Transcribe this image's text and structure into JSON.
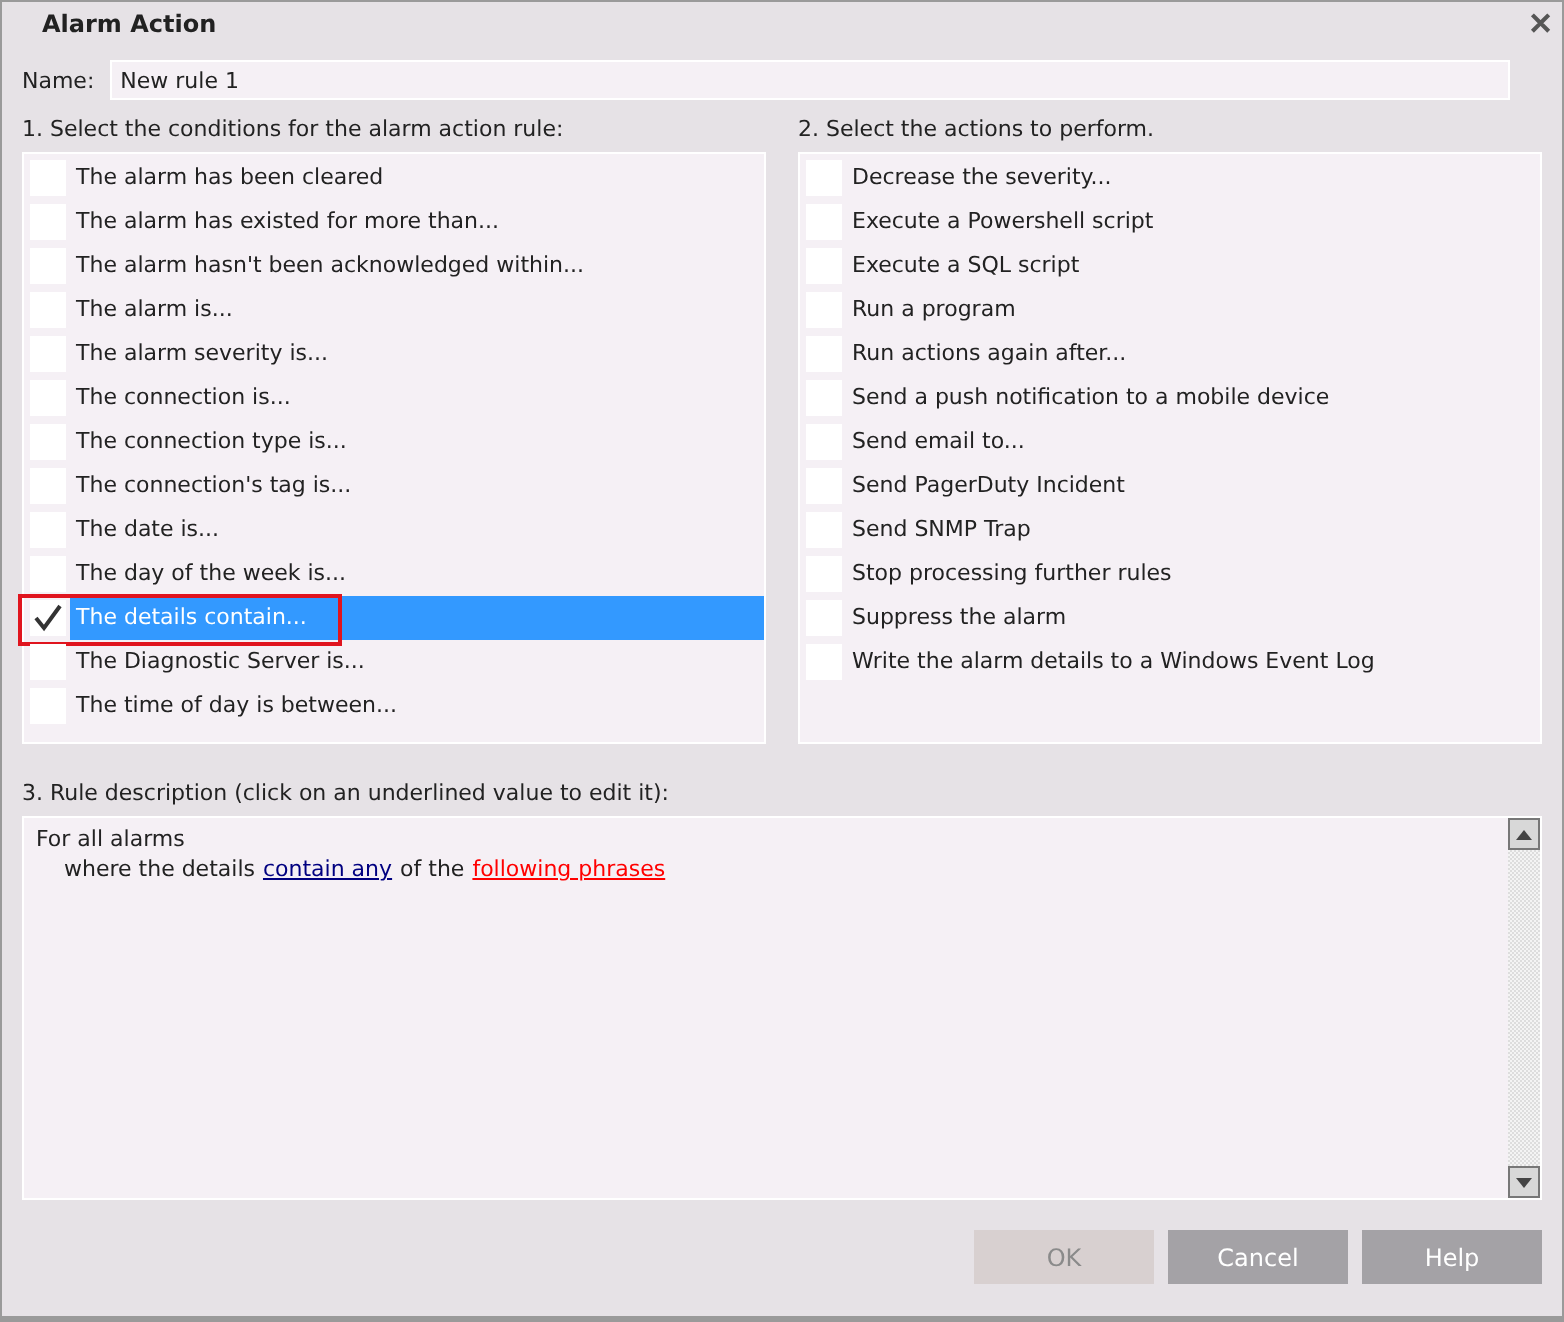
{
  "window": {
    "title": "Alarm Action",
    "close": "✕"
  },
  "name_field": {
    "label": "Name:",
    "value": "New rule 1"
  },
  "conditions": {
    "label": "1. Select the conditions for the alarm action rule:",
    "items": [
      {
        "label": "The alarm has been cleared",
        "checked": false,
        "selected": false,
        "highlighted": false
      },
      {
        "label": "The alarm has existed for more than...",
        "checked": false,
        "selected": false,
        "highlighted": false
      },
      {
        "label": "The alarm hasn't been acknowledged within...",
        "checked": false,
        "selected": false,
        "highlighted": false
      },
      {
        "label": "The alarm is...",
        "checked": false,
        "selected": false,
        "highlighted": false
      },
      {
        "label": "The alarm severity is...",
        "checked": false,
        "selected": false,
        "highlighted": false
      },
      {
        "label": "The connection is...",
        "checked": false,
        "selected": false,
        "highlighted": false
      },
      {
        "label": "The connection type is...",
        "checked": false,
        "selected": false,
        "highlighted": false
      },
      {
        "label": "The connection's tag is...",
        "checked": false,
        "selected": false,
        "highlighted": false
      },
      {
        "label": "The date is...",
        "checked": false,
        "selected": false,
        "highlighted": false
      },
      {
        "label": "The day of the week is...",
        "checked": false,
        "selected": false,
        "highlighted": false
      },
      {
        "label": "The details contain...",
        "checked": true,
        "selected": true,
        "highlighted": true
      },
      {
        "label": "The Diagnostic Server is...",
        "checked": false,
        "selected": false,
        "highlighted": false
      },
      {
        "label": "The time of day is between...",
        "checked": false,
        "selected": false,
        "highlighted": false
      }
    ]
  },
  "actions": {
    "label": "2. Select the actions to perform.",
    "items": [
      {
        "label": "Decrease the severity...",
        "checked": false,
        "selected": false
      },
      {
        "label": "Execute a Powershell script",
        "checked": false,
        "selected": false
      },
      {
        "label": "Execute a SQL script",
        "checked": false,
        "selected": false
      },
      {
        "label": "Run a program",
        "checked": false,
        "selected": false
      },
      {
        "label": "Run actions again after...",
        "checked": false,
        "selected": false
      },
      {
        "label": "Send a push notification to a mobile device",
        "checked": false,
        "selected": false
      },
      {
        "label": "Send email to...",
        "checked": false,
        "selected": false
      },
      {
        "label": "Send PagerDuty Incident",
        "checked": false,
        "selected": false
      },
      {
        "label": "Send SNMP Trap",
        "checked": false,
        "selected": false
      },
      {
        "label": "Stop processing further rules",
        "checked": false,
        "selected": false
      },
      {
        "label": "Suppress the alarm",
        "checked": false,
        "selected": false
      },
      {
        "label": "Write the alarm details to a Windows Event Log",
        "checked": false,
        "selected": false
      }
    ]
  },
  "description": {
    "label": "3. Rule description (click on an underlined value to edit it):",
    "lines": [
      {
        "indented": false,
        "parts": [
          {
            "kind": "text",
            "text": "For all alarms"
          }
        ]
      },
      {
        "indented": true,
        "parts": [
          {
            "kind": "text",
            "text": "where the details"
          },
          {
            "kind": "link",
            "text": "contain any",
            "color": "#000080"
          },
          {
            "kind": "text",
            "text": "of the"
          },
          {
            "kind": "link",
            "text": "following phrases",
            "color": "#ff0000"
          }
        ]
      }
    ]
  },
  "buttons": [
    {
      "label": "OK",
      "disabled": true
    },
    {
      "label": "Cancel",
      "disabled": false
    },
    {
      "label": "Help",
      "disabled": false
    }
  ]
}
